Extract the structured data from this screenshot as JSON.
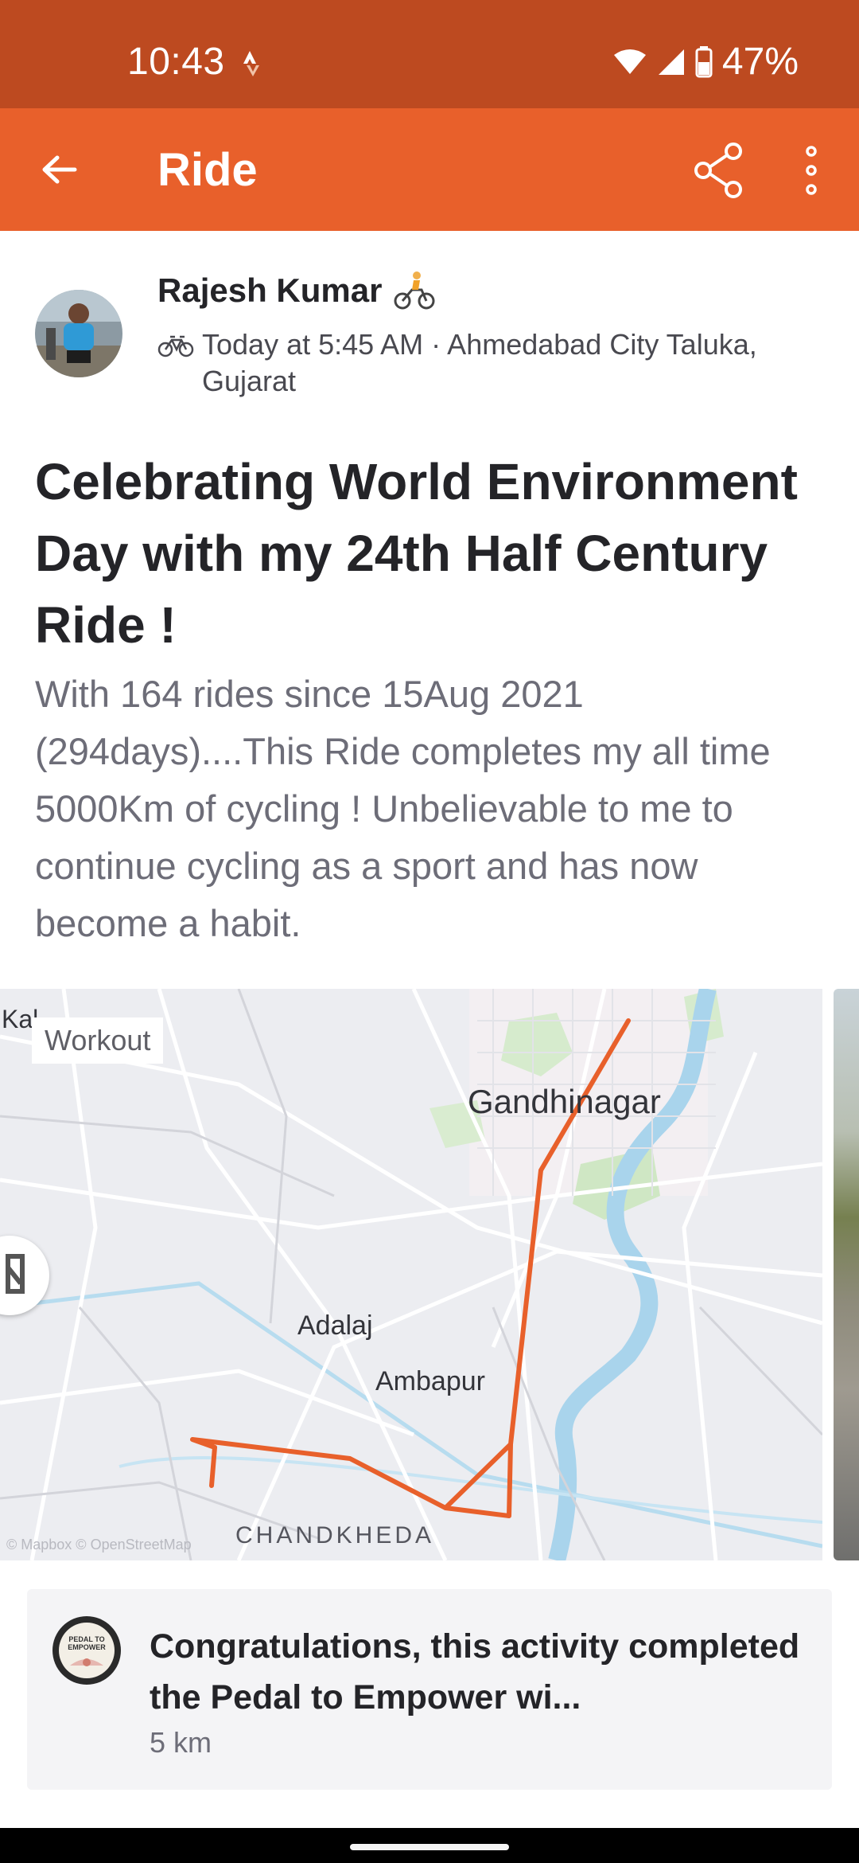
{
  "status_bar": {
    "time": "10:43",
    "battery": "47%"
  },
  "app_bar": {
    "title": "Ride"
  },
  "athlete": {
    "name": "Rajesh Kumar",
    "meta_line1": "Today at 5:45 AM · Ahmedabad City Taluka,",
    "meta_line2": "Gujarat"
  },
  "post": {
    "title": "Celebrating World Environment Day with my 24th Half Century Ride !",
    "description": "With 164 rides since 15Aug 2021 (294days)....This Ride completes my all time 5000Km of cycling ! Unbelievable to me to continue cycling as a sport and has now become a habit."
  },
  "map": {
    "tag": "Workout",
    "labels": {
      "kalol": "Kal",
      "gandhinagar": "Gandhinagar",
      "adalaj": "Adalaj",
      "ambapur": "Ambapur",
      "chandkheda": "CHANDKHEDA"
    },
    "credit": "© Mapbox © OpenStreetMap",
    "route_color": "#e8602b"
  },
  "challenge": {
    "badge_text": "PEDAL TO EMPOWER",
    "text": "Congratulations, this activity completed the Pedal to Empower wi...",
    "distance": "5 km"
  },
  "colors": {
    "status_bar": "#bd4a20",
    "app_bar": "#e8602b",
    "text_primary": "#242428",
    "text_secondary": "#6d6d78"
  }
}
